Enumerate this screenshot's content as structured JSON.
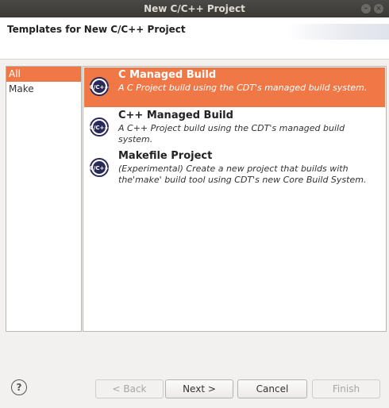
{
  "window": {
    "title": "New C/C++ Project",
    "minimize_glyph": "–",
    "close_glyph": "×"
  },
  "header": {
    "title": "Templates for New C/C++ Project"
  },
  "categories": [
    {
      "label": "All",
      "selected": true
    },
    {
      "label": "Make",
      "selected": false
    }
  ],
  "templates": [
    {
      "name": "C Managed Build",
      "desc_line1": "A C Project build using the CDT's managed build system.",
      "desc_line2": "",
      "icon": "cdt-project-icon",
      "selected": true
    },
    {
      "name": "C++ Managed Build",
      "desc_line1": "A C++ Project build using the CDT's managed build system.",
      "desc_line2": "",
      "icon": "cdt-project-icon",
      "selected": false
    },
    {
      "name": "Makefile Project",
      "desc_line1": "(Experimental) Create a new project that builds with",
      "desc_line2": "the'make' build tool using CDT's new Core Build System.",
      "icon": "cdt-project-icon",
      "selected": false
    }
  ],
  "icon_text": "C/C++",
  "footer": {
    "help_glyph": "?",
    "back_label": "< Back",
    "next_label": "Next >",
    "cancel_label": "Cancel",
    "finish_label": "Finish"
  },
  "colors": {
    "selection": "#f07746",
    "titlebar": "#3c3b37"
  }
}
